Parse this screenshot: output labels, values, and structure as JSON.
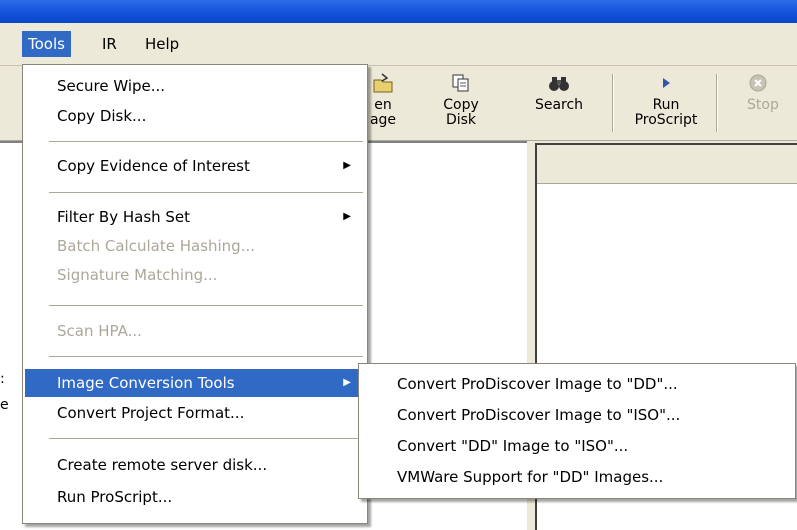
{
  "menubar": {
    "items": [
      {
        "label": "Tools"
      },
      {
        "label": "IR"
      },
      {
        "label": "Help"
      }
    ]
  },
  "toolbar": {
    "open_image_lines": [
      "en",
      "age"
    ],
    "copy_disk_lines": [
      "Copy",
      "Disk"
    ],
    "search_label": "Search",
    "run_proscript_lines": [
      "Run",
      "ProScript"
    ],
    "stop_label": "Stop"
  },
  "left_pane": {
    "edge_chars": [
      ":",
      "e"
    ]
  },
  "tools_menu": {
    "items": [
      {
        "label": "Secure Wipe...",
        "enabled": true
      },
      {
        "label": "Copy Disk...",
        "enabled": true
      },
      {
        "label": "Copy Evidence of Interest",
        "enabled": true,
        "submenu": true
      },
      {
        "label": "Filter By Hash Set",
        "enabled": true,
        "submenu": true
      },
      {
        "label": "Batch Calculate Hashing...",
        "enabled": false
      },
      {
        "label": "Signature Matching...",
        "enabled": false
      },
      {
        "label": "Scan HPA...",
        "enabled": false
      },
      {
        "label": "Image Conversion Tools",
        "enabled": true,
        "submenu": true,
        "highlighted": true
      },
      {
        "label": "Convert Project Format...",
        "enabled": true
      },
      {
        "label": "Create remote server disk...",
        "enabled": true
      },
      {
        "label": "Run ProScript...",
        "enabled": true
      }
    ]
  },
  "image_conversion_submenu": {
    "items": [
      {
        "label": "Convert ProDiscover Image to \"DD\"..."
      },
      {
        "label": "Convert ProDiscover Image to \"ISO\"..."
      },
      {
        "label": "Convert \"DD\" Image to \"ISO\"..."
      },
      {
        "label": "VMWare Support for \"DD\" Images..."
      }
    ]
  },
  "colors": {
    "highlight": "#316ac5",
    "disabled_text": "#aca899",
    "title_bar": "#1150d8"
  },
  "icons": [
    "open-image-icon",
    "copy-disk-icon",
    "search-binoculars-icon",
    "run-script-icon",
    "stop-icon",
    "submenu-arrow-icon"
  ]
}
